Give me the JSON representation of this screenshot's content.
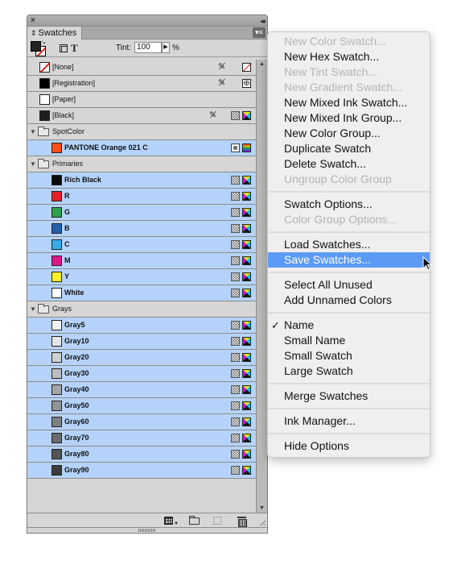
{
  "panel": {
    "title": "Swatches",
    "close_icon": "×",
    "collapse_icon": "◂◂",
    "menu_icon": "▾≡",
    "tint_label": "Tint:",
    "tint_value": "100",
    "tint_unit": "%",
    "text_toggle": "T"
  },
  "swatches": {
    "top": [
      {
        "name": "[None]",
        "color": "none"
      },
      {
        "name": "[Registration]",
        "color": "#000000"
      },
      {
        "name": "[Paper]",
        "color": "#ffffff"
      },
      {
        "name": "[Black]",
        "color": "#1e1e1e"
      }
    ],
    "groups": [
      {
        "name": "SpotColor",
        "items": [
          {
            "name": "PANTONE Orange 021 C",
            "color": "#fe5016",
            "type": "spot"
          }
        ]
      },
      {
        "name": "Primaries",
        "items": [
          {
            "name": "Rich Black",
            "color": "#0a0a0a"
          },
          {
            "name": "R",
            "color": "#e3202a"
          },
          {
            "name": "G",
            "color": "#2ea24a"
          },
          {
            "name": "B",
            "color": "#2360a8"
          },
          {
            "name": "C",
            "color": "#36ade6"
          },
          {
            "name": "M",
            "color": "#e0168a"
          },
          {
            "name": "Y",
            "color": "#fff122"
          },
          {
            "name": "White",
            "color": "#ffffff"
          }
        ]
      },
      {
        "name": "Grays",
        "items": [
          {
            "name": "Gray5",
            "color": "#f3f3f3"
          },
          {
            "name": "Gray10",
            "color": "#e6e6e6"
          },
          {
            "name": "Gray20",
            "color": "#d0d0d0"
          },
          {
            "name": "Gray30",
            "color": "#bcbcbc"
          },
          {
            "name": "Gray40",
            "color": "#a5a5a5"
          },
          {
            "name": "Gray50",
            "color": "#939393"
          },
          {
            "name": "Gray60",
            "color": "#808080"
          },
          {
            "name": "Gray70",
            "color": "#6a6a6a"
          },
          {
            "name": "Gray80",
            "color": "#555555"
          },
          {
            "name": "Gray90",
            "color": "#3c3c3c"
          }
        ]
      }
    ]
  },
  "menu": {
    "items": [
      {
        "label": "New Color Swatch...",
        "state": "disabled"
      },
      {
        "label": "New Hex Swatch...",
        "state": "enabled"
      },
      {
        "label": "New Tint Swatch...",
        "state": "disabled"
      },
      {
        "label": "New Gradient Swatch...",
        "state": "disabled"
      },
      {
        "label": "New Mixed Ink Swatch...",
        "state": "enabled"
      },
      {
        "label": "New Mixed Ink Group...",
        "state": "enabled"
      },
      {
        "label": "New Color Group...",
        "state": "enabled"
      },
      {
        "label": "Duplicate Swatch",
        "state": "enabled"
      },
      {
        "label": "Delete Swatch...",
        "state": "enabled"
      },
      {
        "label": "Ungroup Color Group",
        "state": "disabled"
      },
      {
        "separator": true
      },
      {
        "label": "Swatch Options...",
        "state": "enabled"
      },
      {
        "label": "Color Group Options...",
        "state": "disabled"
      },
      {
        "separator": true
      },
      {
        "label": "Load Swatches...",
        "state": "enabled"
      },
      {
        "label": "Save Swatches...",
        "state": "highlighted"
      },
      {
        "separator": true
      },
      {
        "label": "Select All Unused",
        "state": "enabled"
      },
      {
        "label": "Add Unnamed Colors",
        "state": "enabled"
      },
      {
        "separator": true
      },
      {
        "label": "Name",
        "state": "enabled",
        "checked": true
      },
      {
        "label": "Small Name",
        "state": "enabled"
      },
      {
        "label": "Small Swatch",
        "state": "enabled"
      },
      {
        "label": "Large Swatch",
        "state": "enabled"
      },
      {
        "separator": true
      },
      {
        "label": "Merge Swatches",
        "state": "enabled"
      },
      {
        "separator": true
      },
      {
        "label": "Ink Manager...",
        "state": "enabled"
      },
      {
        "separator": true
      },
      {
        "label": "Hide Options",
        "state": "enabled"
      }
    ],
    "check_glyph": "✓"
  },
  "colors": {
    "selection": "#b5d3fa",
    "menu_highlight": "#5c9bf5",
    "panel_bg": "#d6d6d6"
  }
}
